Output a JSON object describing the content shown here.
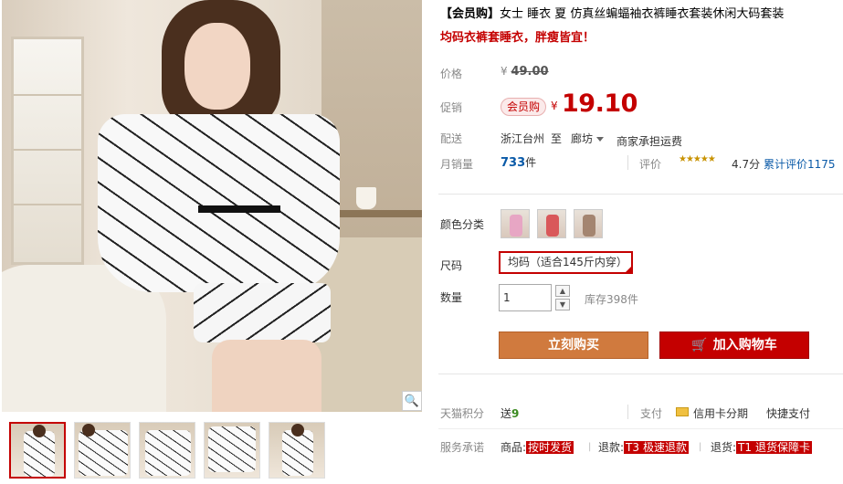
{
  "title": {
    "prefix": "【会员购】",
    "text": "女士 睡衣 夏 仿真丝蝙蝠袖衣裤睡衣套装休闲大码套装",
    "subtitle": "均码衣裤套睡衣，胖瘦皆宜！"
  },
  "price": {
    "label": "价格",
    "currency": "¥",
    "original": "49.00"
  },
  "promo": {
    "label": "促销",
    "tag": "会员购",
    "currency": "¥",
    "price": "19.10"
  },
  "shipping": {
    "label": "配送",
    "from": "浙江台州",
    "to_word": "至",
    "destination": "廊坊",
    "fee_note": "商家承担运费"
  },
  "sales": {
    "label": "月销量",
    "count": "733",
    "unit": "件",
    "rating_label": "评价",
    "stars": "★★★★★",
    "score": "4.7分",
    "review_text": "累计评价1175"
  },
  "sku": {
    "color_label": "颜色分类",
    "colors": [
      {
        "icon": "pink-pajama-swatch",
        "color": "#e7a6c4"
      },
      {
        "icon": "red-pajama-swatch",
        "color": "#d9585a"
      },
      {
        "icon": "print-pajama-swatch",
        "color": "#a48570"
      }
    ],
    "size_label": "尺码",
    "size_value": "均码（适合145斤内穿）",
    "qty_label": "数量",
    "qty_value": "1",
    "stock": "库存398件",
    "buy_button": "立刻购买",
    "cart_button": "加入购物车"
  },
  "points": {
    "label": "天猫积分",
    "send": "送",
    "value": "9",
    "pay_label": "支付",
    "card_pay": "信用卡分期",
    "fast_pay": "快捷支付"
  },
  "service": {
    "label": "服务承诺",
    "goods_prefix": "商品:",
    "goods_tag": "按时发货",
    "refund_prefix": "退款:",
    "refund_tag": "T3",
    "refund_text": "极速退款",
    "return_prefix": "退货:",
    "return_tag": "T1",
    "return_text": "退货保障卡"
  },
  "colors": {
    "accent": "#c40000",
    "buy": "#d07a3e",
    "link": "#0a5aa8"
  }
}
